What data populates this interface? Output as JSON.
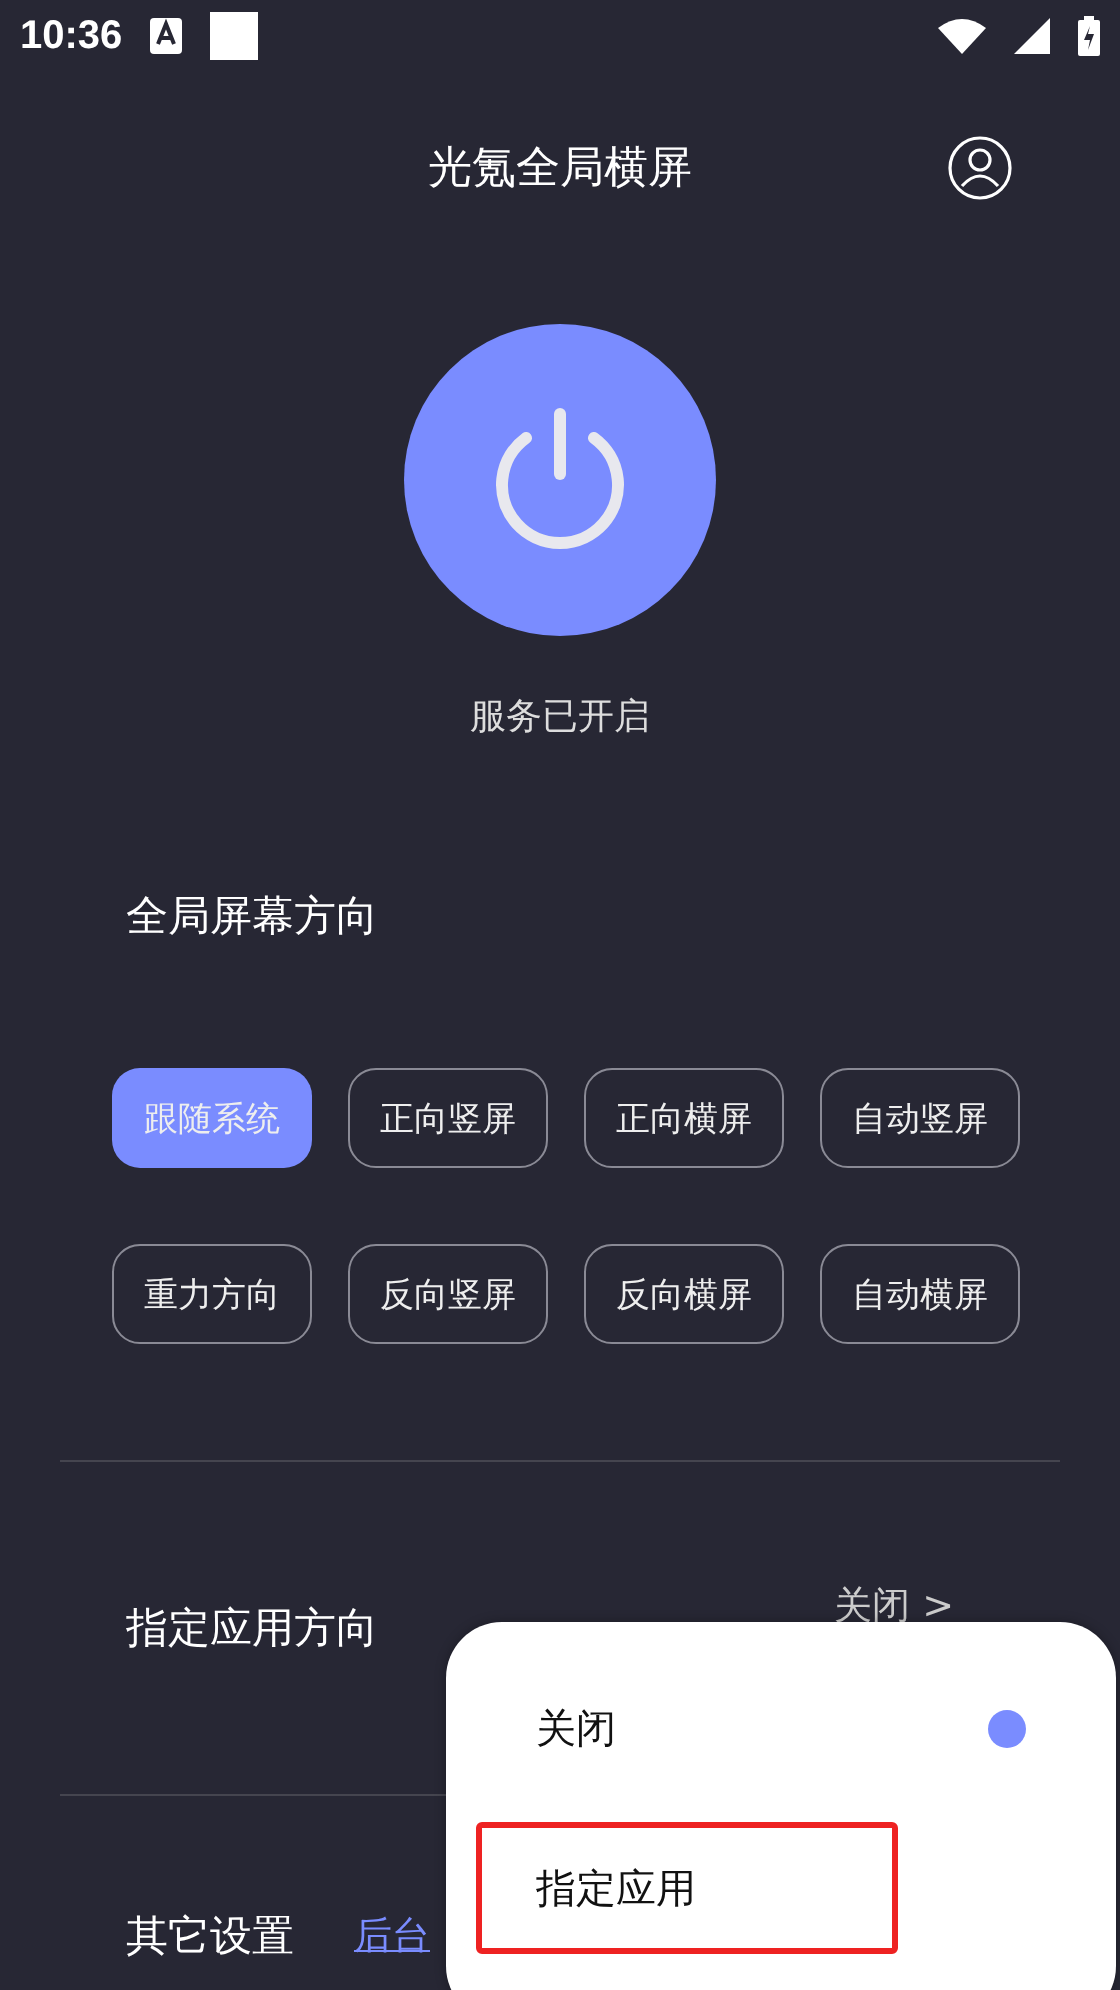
{
  "status_bar": {
    "time": "10:36"
  },
  "header": {
    "title": "光氪全局横屏"
  },
  "power": {
    "on": true,
    "status": "服务已开启"
  },
  "orientation": {
    "title": "全局屏幕方向",
    "options": [
      {
        "label": "跟随系统",
        "selected": true
      },
      {
        "label": "正向竖屏",
        "selected": false
      },
      {
        "label": "正向横屏",
        "selected": false
      },
      {
        "label": "自动竖屏",
        "selected": false
      },
      {
        "label": "重力方向",
        "selected": false
      },
      {
        "label": "反向竖屏",
        "selected": false
      },
      {
        "label": "反向横屏",
        "selected": false
      },
      {
        "label": "自动横屏",
        "selected": false
      }
    ]
  },
  "app_orientation": {
    "label": "指定应用方向",
    "value": "关闭",
    "chevron": ">"
  },
  "other": {
    "label": "其它设置",
    "link": "后台"
  },
  "menu": {
    "items": [
      {
        "label": "关闭",
        "selected": true,
        "highlighted": false
      },
      {
        "label": "指定应用",
        "selected": false,
        "highlighted": true
      }
    ]
  }
}
